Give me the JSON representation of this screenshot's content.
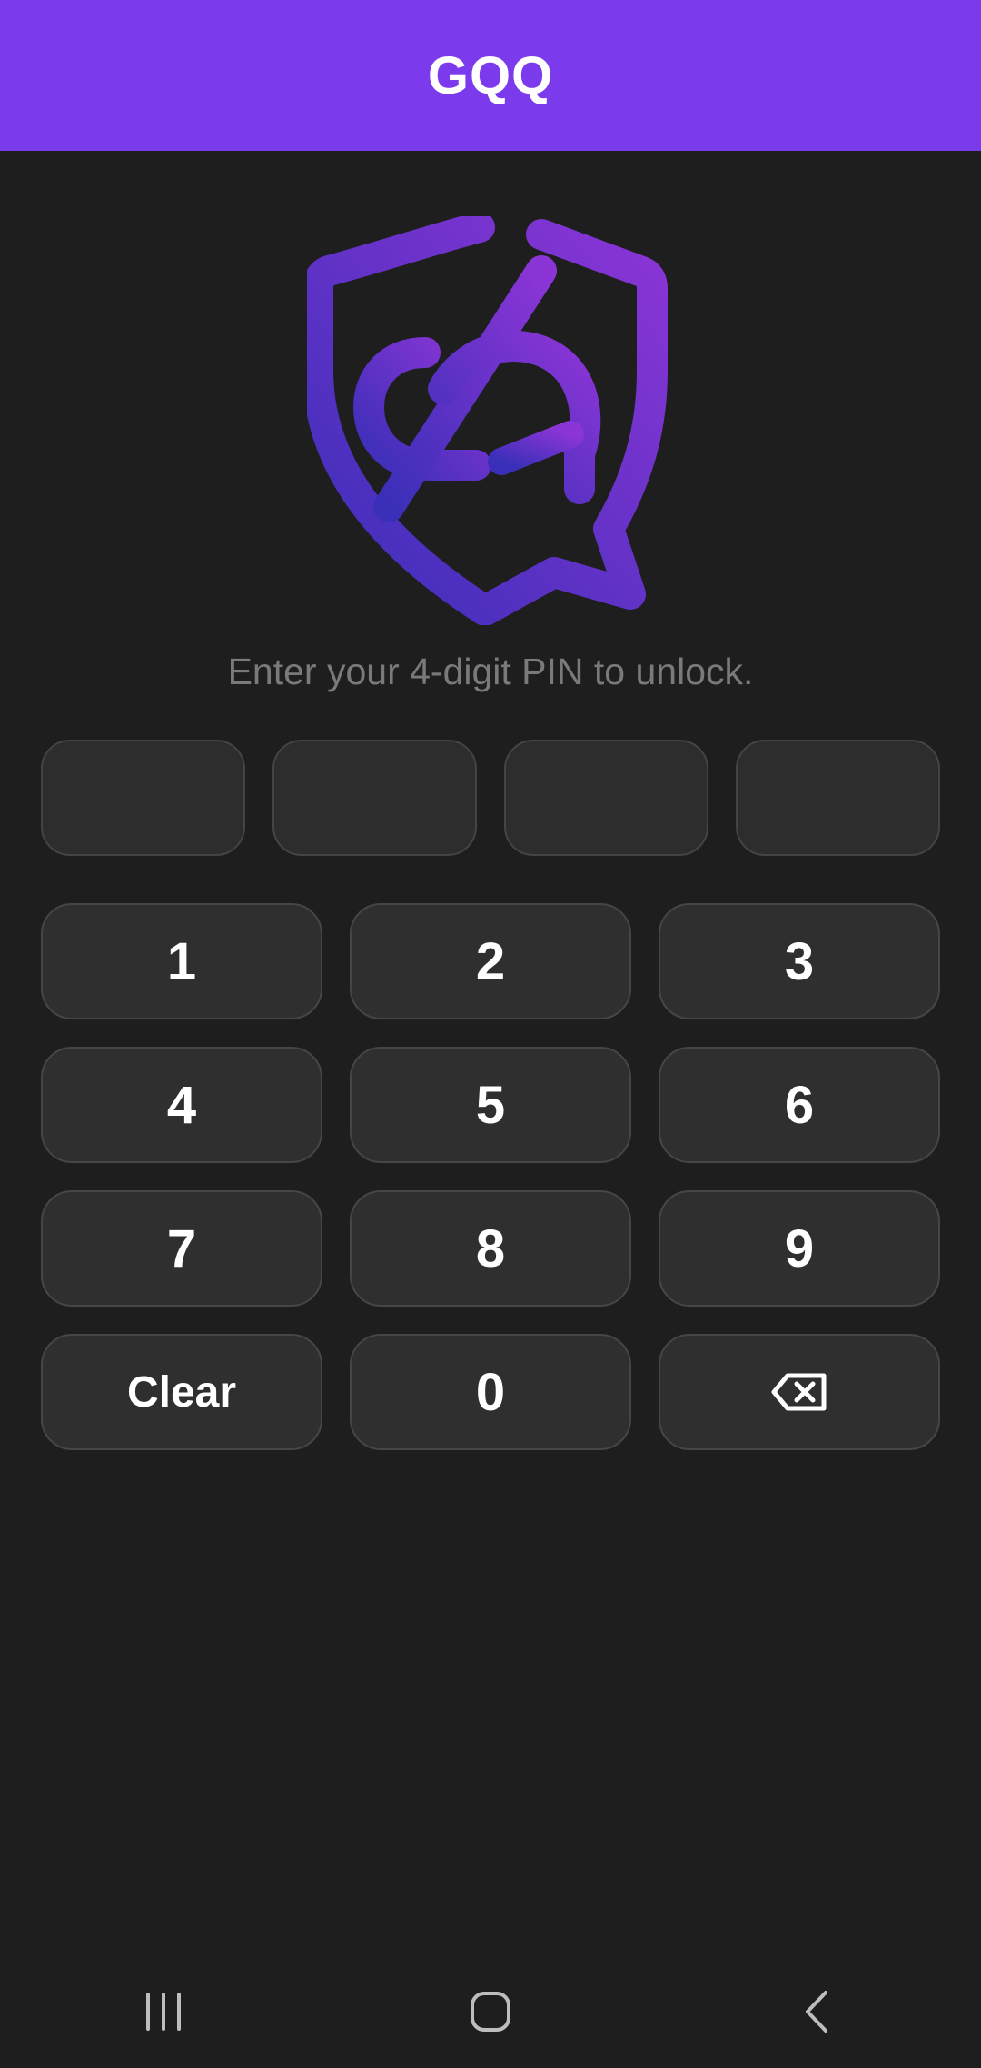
{
  "app_bar": {
    "title": "GQQ",
    "color": "#7c3aed"
  },
  "logo": {
    "icon": "shield-chat-logo",
    "gradient": [
      "#3a2fb8",
      "#8b35d6"
    ]
  },
  "prompt": {
    "text": "Enter your 4-digit PIN to unlock."
  },
  "pin": {
    "length": 4,
    "entered": 0
  },
  "keypad": {
    "keys": [
      "1",
      "2",
      "3",
      "4",
      "5",
      "6",
      "7",
      "8",
      "9"
    ],
    "clear_label": "Clear",
    "zero_label": "0",
    "backspace_icon": "backspace-icon"
  },
  "navigation": {
    "recents_icon": "recents-icon",
    "home_icon": "home-icon",
    "back_icon": "back-icon"
  }
}
